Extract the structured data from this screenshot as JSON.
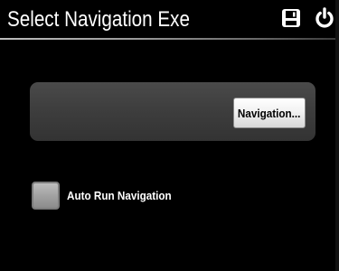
{
  "header": {
    "title": "Select Navigation Exe",
    "save_icon": "save-icon",
    "power_icon": "power-icon"
  },
  "panel": {
    "navigation_button_label": "Navigation..."
  },
  "options": {
    "auto_run_label": "Auto Run Navigation",
    "auto_run_checked": false
  },
  "colors": {
    "background": "#000000",
    "panel": "#3d3d3d",
    "button": "#f2f2f2",
    "checkbox": "#a2a2a2"
  }
}
